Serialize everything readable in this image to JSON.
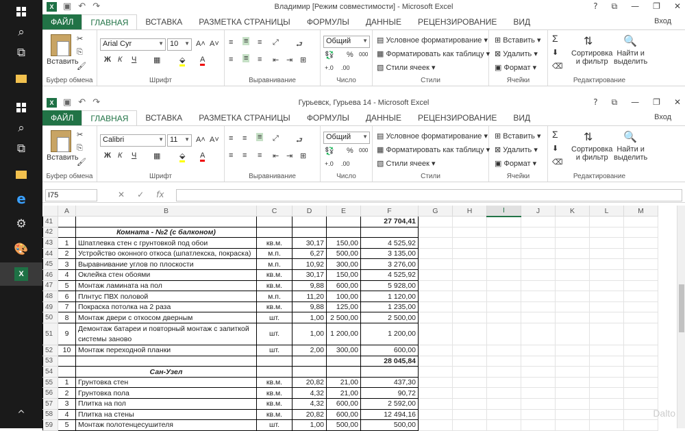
{
  "taskbar": {
    "items": [
      "windows-logo",
      "search",
      "task-view",
      "file-explorer",
      "windows-logo",
      "search",
      "task-view",
      "file-explorer",
      "edge",
      "settings",
      "paint",
      "excel"
    ],
    "bottom_chevron": "^"
  },
  "window1": {
    "title": "Владимир  [Режим совместимости] - Microsoft Excel",
    "font_name": "Arial Cyr",
    "font_size": "10"
  },
  "window2": {
    "title": "Гурьевск, Гурьева 14 - Microsoft Excel",
    "font_name": "Calibri",
    "font_size": "11"
  },
  "window_buttons": {
    "help": "?",
    "restore_ribbon": "⧉",
    "minimize": "—",
    "maximize": "❐",
    "close": "✕"
  },
  "tabs": {
    "file": "ФАЙЛ",
    "home": "ГЛАВНАЯ",
    "insert": "ВСТАВКА",
    "layout": "РАЗМЕТКА СТРАНИЦЫ",
    "formulas": "ФОРМУЛЫ",
    "data": "ДАННЫЕ",
    "review": "РЕЦЕНЗИРОВАНИЕ",
    "view": "ВИД"
  },
  "login": "Вход",
  "ribbon": {
    "paste": "Вставить",
    "clipboard": "Буфер обмена",
    "font": "Шрифт",
    "alignment": "Выравнивание",
    "number_format": "Общий",
    "number": "Число",
    "cond_format": "Условное форматирование",
    "format_table": "Форматировать как таблицу",
    "cell_styles": "Стили ячеек",
    "styles": "Стили",
    "insert": "Вставить",
    "delete": "Удалить",
    "format": "Формат",
    "cells": "Ячейки",
    "sort_filter_1": "Сортировка",
    "sort_filter_2": "и фильтр",
    "find_select_1": "Найти и",
    "find_select_2": "выделить",
    "editing": "Редактирование",
    "bold": "Ж",
    "italic": "К",
    "underline": "Ч",
    "font_color": "А",
    "percent": "%",
    "thousands": "000",
    "sigma": "Σ"
  },
  "formula_bar": {
    "name_box": "I75",
    "fx": "fx",
    "formula": ""
  },
  "columns": [
    "A",
    "B",
    "C",
    "D",
    "E",
    "F",
    "G",
    "H",
    "I",
    "J",
    "K",
    "L",
    "M"
  ],
  "selected_column": "I",
  "rows": [
    {
      "n": "41",
      "a": "",
      "b": "",
      "c": "",
      "d": "",
      "e": "",
      "f": "27 704,41",
      "type": "total"
    },
    {
      "n": "42",
      "a": "",
      "b": "Комната - №2 (с балконом)",
      "c": "",
      "d": "",
      "e": "",
      "f": "",
      "type": "section"
    },
    {
      "n": "43",
      "a": "1",
      "b": "Шпатлевка стен с грунтовкой под обои",
      "c": "кв.м.",
      "d": "30,17",
      "e": "150,00",
      "f": "4 525,92",
      "type": "item"
    },
    {
      "n": "44",
      "a": "2",
      "b": "Устройство оконного откоса (шпатлекска, покраска)",
      "c": "м.п.",
      "d": "6,27",
      "e": "500,00",
      "f": "3 135,00",
      "type": "item"
    },
    {
      "n": "45",
      "a": "3",
      "b": "Выравнивание углов по плоскости",
      "c": "м.п.",
      "d": "10,92",
      "e": "300,00",
      "f": "3 276,00",
      "type": "item"
    },
    {
      "n": "46",
      "a": "4",
      "b": "Оклейка стен обоями",
      "c": "кв.м.",
      "d": "30,17",
      "e": "150,00",
      "f": "4 525,92",
      "type": "item"
    },
    {
      "n": "47",
      "a": "5",
      "b": "Монтаж ламината на пол",
      "c": "кв.м.",
      "d": "9,88",
      "e": "600,00",
      "f": "5 928,00",
      "type": "item"
    },
    {
      "n": "48",
      "a": "6",
      "b": "Плнтус ПВХ половой",
      "c": "м.п.",
      "d": "11,20",
      "e": "100,00",
      "f": "1 120,00",
      "type": "item"
    },
    {
      "n": "49",
      "a": "7",
      "b": "Покраска потолка на 2 раза",
      "c": "кв.м.",
      "d": "9,88",
      "e": "125,00",
      "f": "1 235,00",
      "type": "item"
    },
    {
      "n": "50",
      "a": "8",
      "b": "Монтаж двери с откосом дверным",
      "c": "шт.",
      "d": "1,00",
      "e": "2 500,00",
      "f": "2 500,00",
      "type": "item"
    },
    {
      "n": "51",
      "a": "9",
      "b": "Демонтаж батареи и повторный монтаж с запиткой системы заново",
      "c": "шт.",
      "d": "1,00",
      "e": "1 200,00",
      "f": "1 200,00",
      "type": "tall"
    },
    {
      "n": "52",
      "a": "10",
      "b": "Монтаж переходной планки",
      "c": "шт.",
      "d": "2,00",
      "e": "300,00",
      "f": "600,00",
      "type": "item"
    },
    {
      "n": "53",
      "a": "",
      "b": "",
      "c": "",
      "d": "",
      "e": "",
      "f": "28 045,84",
      "type": "total"
    },
    {
      "n": "54",
      "a": "",
      "b": "Сан-Узел",
      "c": "",
      "d": "",
      "e": "",
      "f": "",
      "type": "section"
    },
    {
      "n": "55",
      "a": "1",
      "b": "Грунтовка стен",
      "c": "кв.м.",
      "d": "20,82",
      "e": "21,00",
      "f": "437,30",
      "type": "item"
    },
    {
      "n": "56",
      "a": "2",
      "b": "Грунтовка пола",
      "c": "кв.м.",
      "d": "4,32",
      "e": "21,00",
      "f": "90,72",
      "type": "item"
    },
    {
      "n": "57",
      "a": "3",
      "b": "Плитка на пол",
      "c": "кв.м.",
      "d": "4,32",
      "e": "600,00",
      "f": "2 592,00",
      "type": "item"
    },
    {
      "n": "58",
      "a": "4",
      "b": "Плитка на стены",
      "c": "кв.м.",
      "d": "20,82",
      "e": "600,00",
      "f": "12 494,16",
      "type": "item"
    },
    {
      "n": "59",
      "a": "5",
      "b": "Монтаж полотенцесушителя",
      "c": "шт.",
      "d": "1,00",
      "e": "500,00",
      "f": "500,00",
      "type": "item"
    }
  ],
  "watermark": "Dalto"
}
